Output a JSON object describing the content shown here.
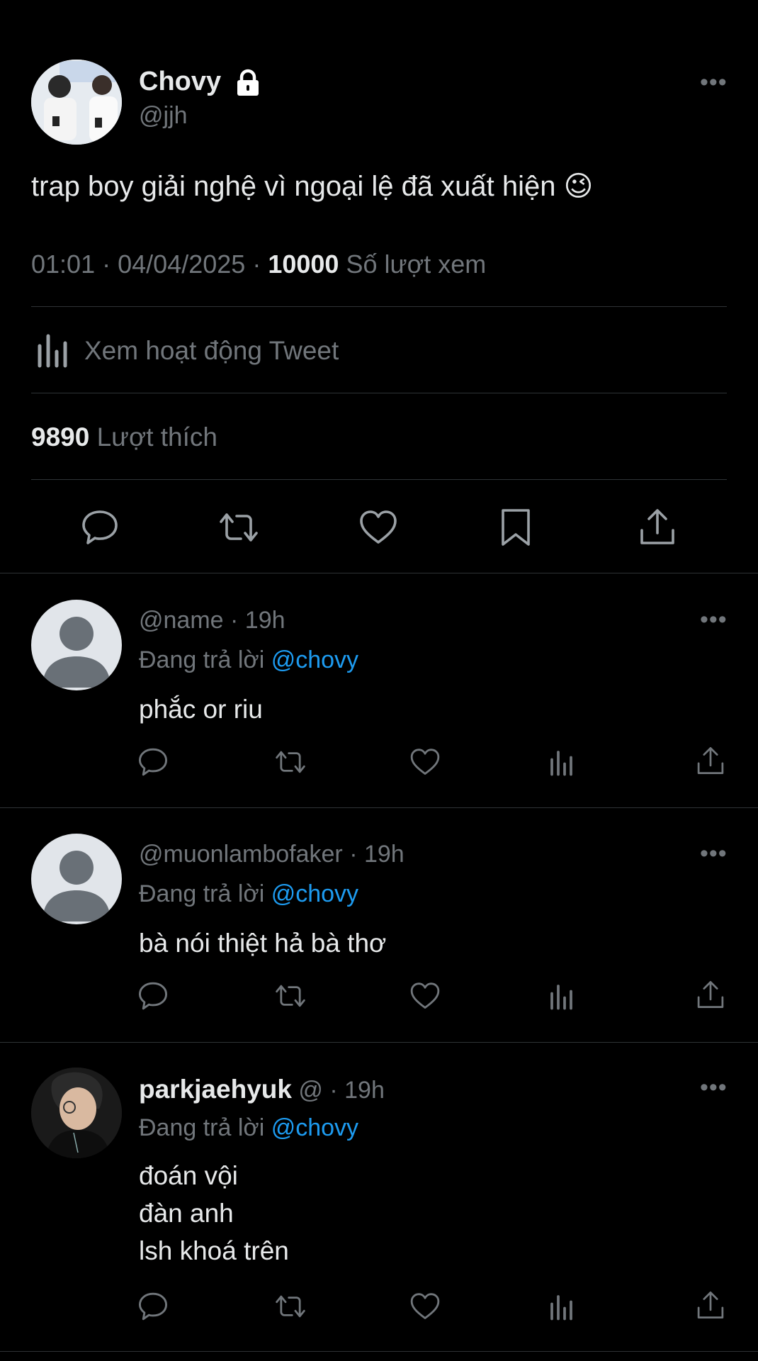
{
  "main_tweet": {
    "display_name": "Chovy",
    "handle": "@jjh",
    "text": "trap boy giải nghệ vì ngoại lệ đã xuất hiện 😉",
    "time": "01:01",
    "sep": "·",
    "date": "04/04/2025",
    "views_count": "10000",
    "views_label": "Số lượt xem",
    "activity_label": "Xem hoạt động Tweet",
    "likes_count": "9890",
    "likes_label": "Lượt thích"
  },
  "replies": [
    {
      "display_name": "",
      "handle": "@name",
      "time": "· 19h",
      "replying_label": "Đang trả lời",
      "replying_to": "@chovy",
      "text_lines": [
        "phắc or riu"
      ]
    },
    {
      "display_name": "",
      "handle": "@muonlambofaker",
      "time": "· 19h",
      "replying_label": "Đang trả lời",
      "replying_to": "@chovy",
      "text_lines": [
        "bà nói thiệt hả bà thơ"
      ]
    },
    {
      "display_name": "parkjaehyuk",
      "handle": "@",
      "time": "· 19h",
      "replying_label": "Đang trả lời",
      "replying_to": "@chovy",
      "text_lines": [
        "đoán vội",
        "đàn anh",
        "lsh khoá trên"
      ]
    }
  ],
  "colors": {
    "background": "#000000",
    "text": "#e7e9ea",
    "secondary": "#71767b",
    "link": "#1d9bf0",
    "divider": "#2f3336"
  }
}
